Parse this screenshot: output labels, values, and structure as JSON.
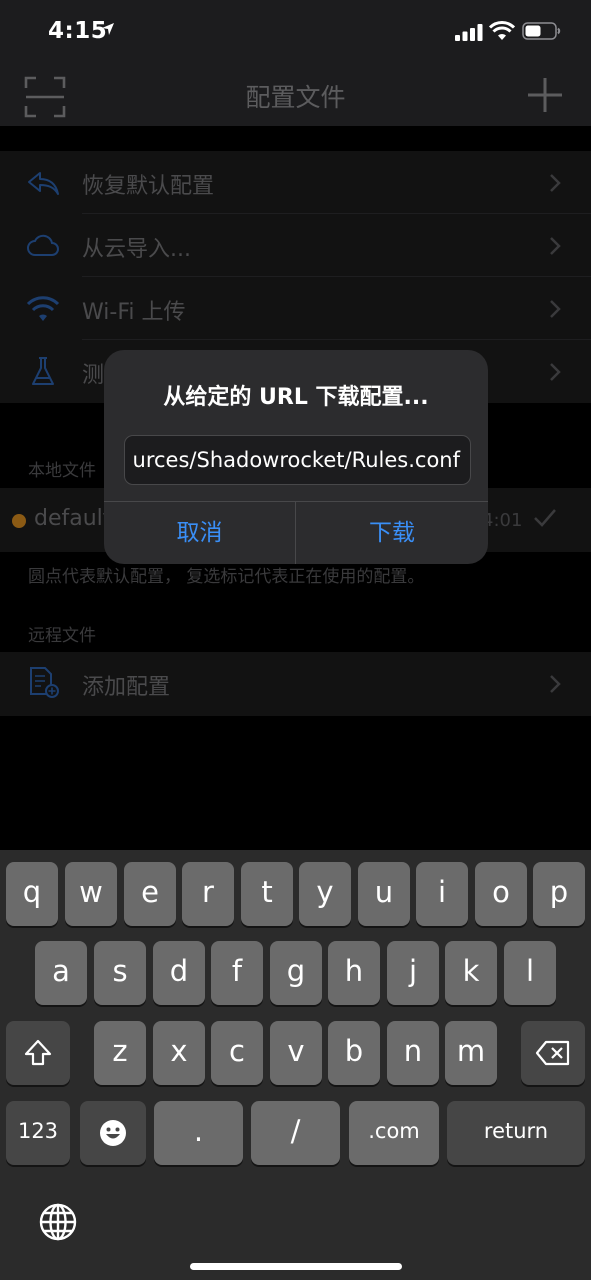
{
  "status_bar": {
    "time": "4:15"
  },
  "nav": {
    "title": "配置文件"
  },
  "menu_items": [
    {
      "label": "恢复默认配置",
      "icon": "undo-icon"
    },
    {
      "label": "从云导入...",
      "icon": "cloud-icon"
    },
    {
      "label": "Wi-Fi 上传",
      "icon": "wifi-icon"
    },
    {
      "label": "测",
      "icon": "flask-icon"
    }
  ],
  "local": {
    "header": "本地文件",
    "file_name": "default",
    "file_time": "4:01",
    "footer": "圆点代表默认配置， 复选标记代表正在使用的配置。"
  },
  "remote": {
    "header": "远程文件",
    "add_label": "添加配置"
  },
  "alert": {
    "title": "从给定的 URL 下载配置...",
    "input_value": "urces/Shadowrocket/Rules.conf",
    "cancel": "取消",
    "confirm": "下载"
  },
  "keyboard": {
    "row1": [
      "q",
      "w",
      "e",
      "r",
      "t",
      "y",
      "u",
      "i",
      "o",
      "p"
    ],
    "row2": [
      "a",
      "s",
      "d",
      "f",
      "g",
      "h",
      "j",
      "k",
      "l"
    ],
    "row3": [
      "z",
      "x",
      "c",
      "v",
      "b",
      "n",
      "m"
    ],
    "numbers": "123",
    "period": ".",
    "slash": "/",
    "dotcom": ".com",
    "return": "return"
  },
  "colors": {
    "accent": "#3a8ff7",
    "default_dot": "#d68a1f"
  }
}
